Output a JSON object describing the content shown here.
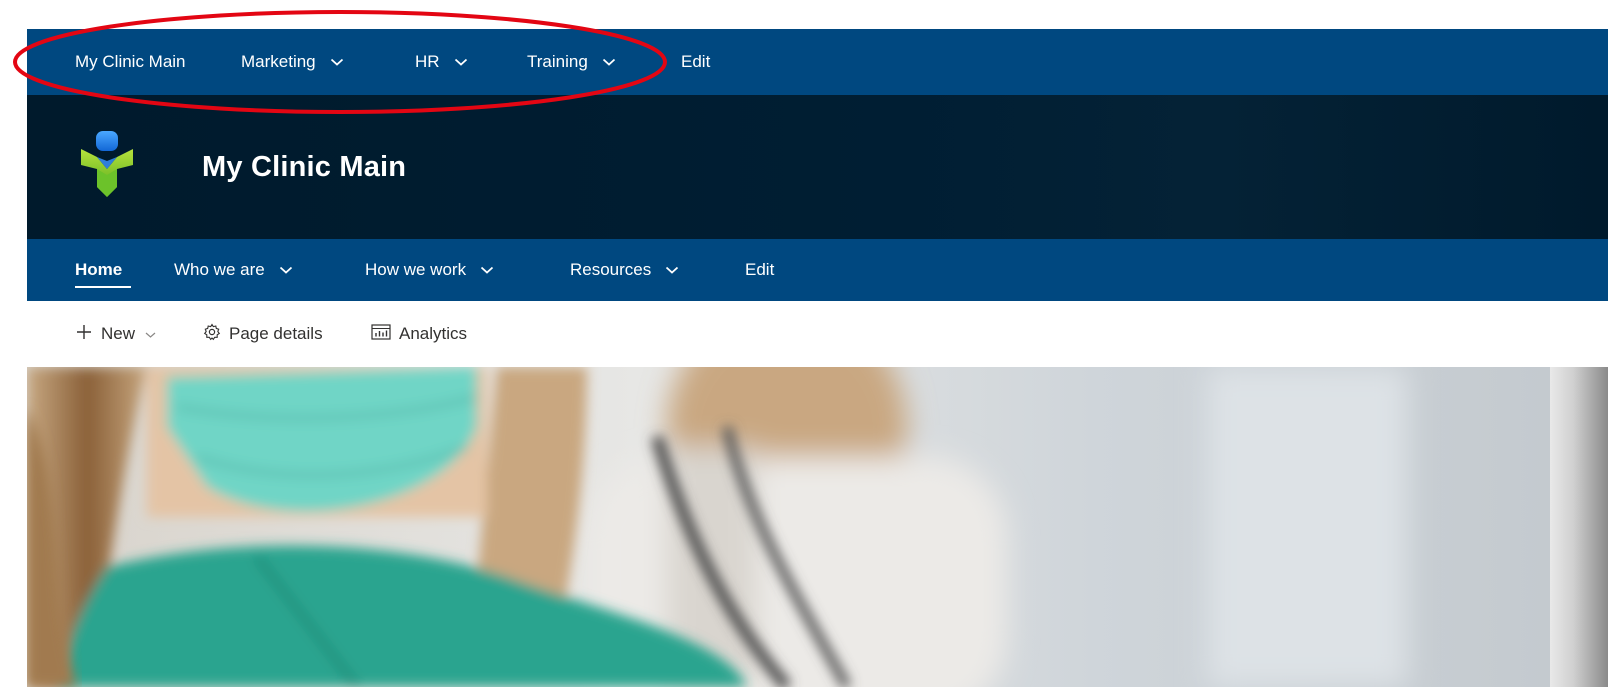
{
  "hub_nav": {
    "items": [
      {
        "label": "My Clinic Main",
        "has_dropdown": false
      },
      {
        "label": "Marketing",
        "has_dropdown": true
      },
      {
        "label": "HR",
        "has_dropdown": true
      },
      {
        "label": "Training",
        "has_dropdown": true
      },
      {
        "label": "Edit",
        "has_dropdown": false
      }
    ]
  },
  "site_header": {
    "title": "My Clinic Main",
    "logo_icon": "clinic-logo-icon"
  },
  "site_nav": {
    "items": [
      {
        "label": "Home",
        "active": true,
        "has_dropdown": false
      },
      {
        "label": "Who we are",
        "active": false,
        "has_dropdown": true
      },
      {
        "label": "How we work",
        "active": false,
        "has_dropdown": true
      },
      {
        "label": "Resources",
        "active": false,
        "has_dropdown": true
      },
      {
        "label": "Edit",
        "active": false,
        "has_dropdown": false
      }
    ]
  },
  "command_bar": {
    "new_label": "New",
    "page_details_label": "Page details",
    "analytics_label": "Analytics"
  },
  "colors": {
    "nav_blue": "#004880",
    "header_dark": "#001a2c",
    "annotation_red": "#e30613"
  }
}
